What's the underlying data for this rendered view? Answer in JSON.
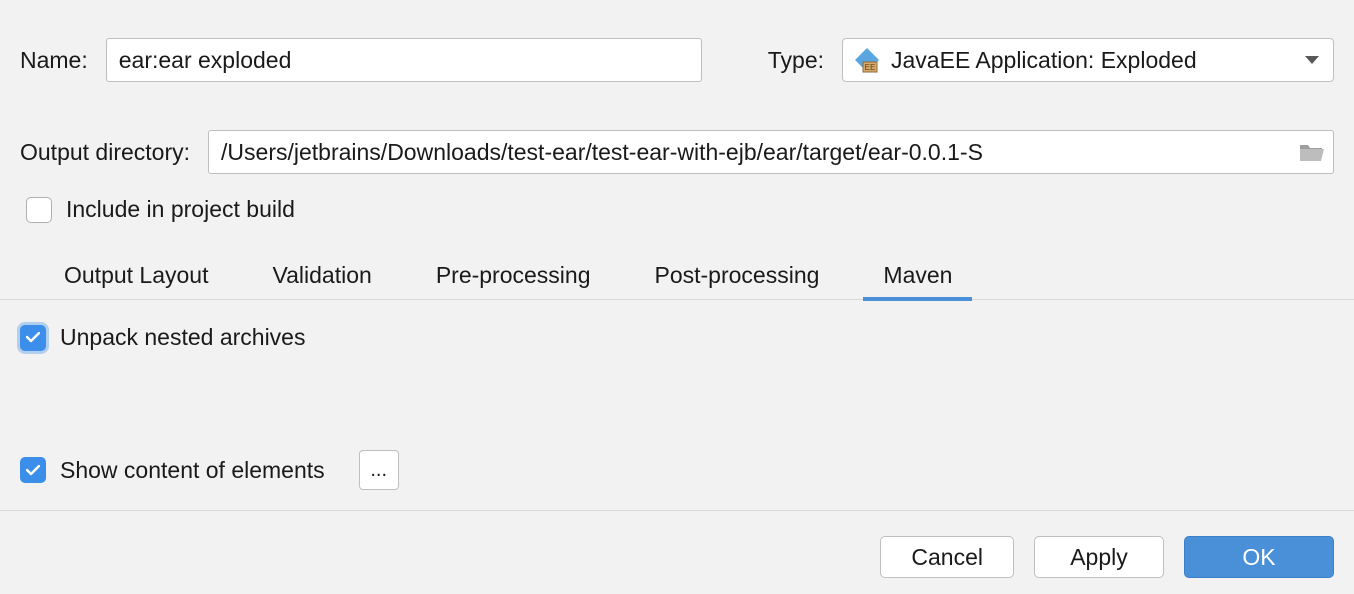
{
  "name": {
    "label": "Name:",
    "value": "ear:ear exploded"
  },
  "type": {
    "label": "Type:",
    "value": "JavaEE Application: Exploded"
  },
  "output_directory": {
    "label": "Output directory:",
    "value": "/Users/jetbrains/Downloads/test-ear/test-ear-with-ejb/ear/target/ear-0.0.1-S"
  },
  "include_in_build": {
    "label": "Include in project build",
    "checked": false
  },
  "tabs": [
    {
      "label": "Output Layout",
      "active": false
    },
    {
      "label": "Validation",
      "active": false
    },
    {
      "label": "Pre-processing",
      "active": false
    },
    {
      "label": "Post-processing",
      "active": false
    },
    {
      "label": "Maven",
      "active": true
    }
  ],
  "maven": {
    "unpack_label": "Unpack nested archives",
    "unpack_checked": true
  },
  "show_content": {
    "label": "Show content of elements",
    "checked": true,
    "ellipsis": "..."
  },
  "buttons": {
    "cancel": "Cancel",
    "apply": "Apply",
    "ok": "OK"
  }
}
